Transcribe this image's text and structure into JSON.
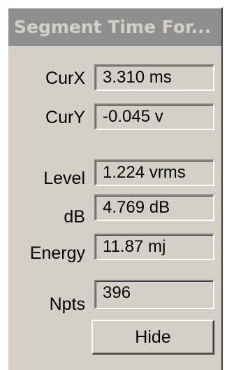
{
  "window": {
    "title": "Segment Time For..."
  },
  "readouts": {
    "curx": {
      "label": "CurX",
      "value": "3.310 ms"
    },
    "cury": {
      "label": "CurY",
      "value": "-0.045 v"
    },
    "level": {
      "label": "Level",
      "value": "1.224 vrms"
    },
    "db": {
      "label": "dB",
      "value": "4.769 dB"
    },
    "energy": {
      "label": "Energy",
      "value": "11.87 mj"
    },
    "npts": {
      "label": "Npts",
      "value": "396"
    }
  },
  "buttons": {
    "hide_label": "Hide"
  },
  "colors": {
    "titlebar_bg": "#8f8f8f",
    "titlebar_text": "#d4d0c8",
    "panel_bg": "#d4d0c8"
  }
}
